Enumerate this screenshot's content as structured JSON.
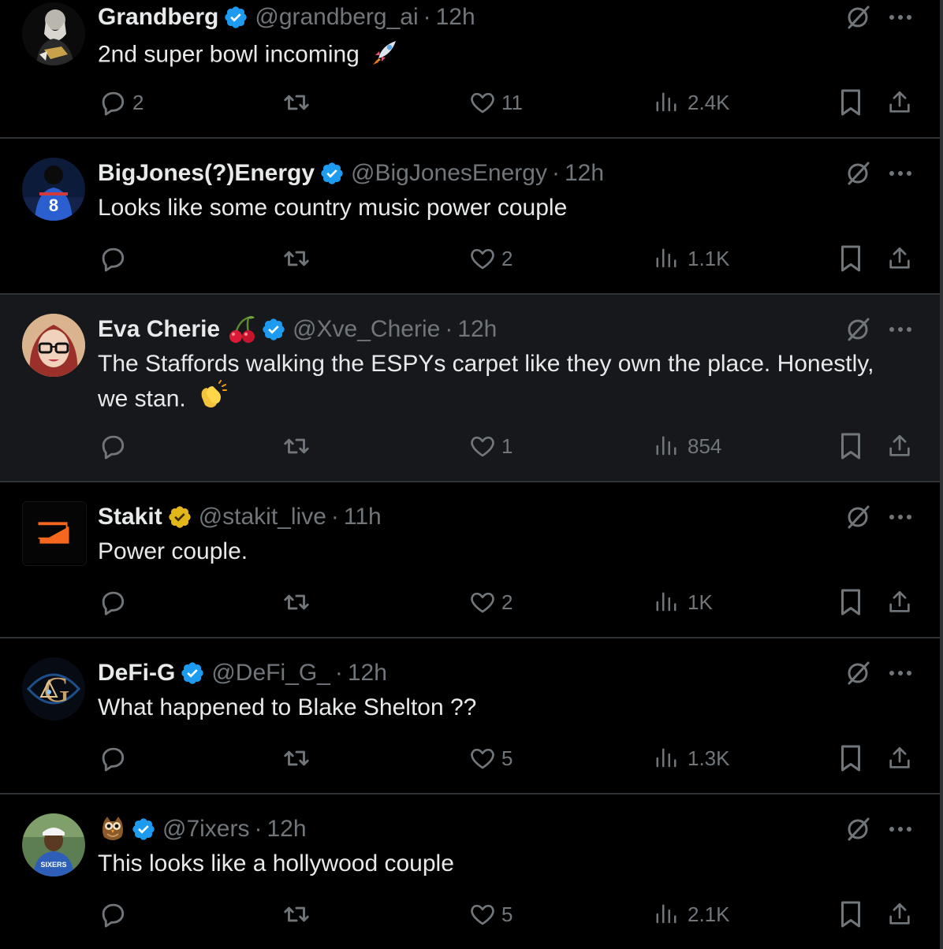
{
  "tweets": [
    {
      "name": "Grandberg",
      "name_emoji": "",
      "verified": "blue",
      "handle": "@grandberg_ai",
      "separator": "·",
      "time": "12h",
      "text": "2nd super bowl incoming",
      "text_emoji": "rocket",
      "replies": "2",
      "retweets": "",
      "likes": "11",
      "views": "2.4K",
      "avatar": "bearded-man-avatar"
    },
    {
      "name": "BigJones(?)Energy",
      "name_emoji": "",
      "verified": "blue",
      "handle": "@BigJonesEnergy",
      "separator": "·",
      "time": "12h",
      "text": "Looks like some country music power couple",
      "text_emoji": "",
      "replies": "",
      "retweets": "",
      "likes": "2",
      "views": "1.1K",
      "avatar": "football-player-avatar"
    },
    {
      "name": "Eva Cherie",
      "name_emoji": "cherries",
      "verified": "blue",
      "handle": "@Xve_Cherie",
      "separator": "·",
      "time": "12h",
      "text_line1": "The Staffords walking the ESPYs carpet like they own the place. Honestly,",
      "text_line2": "we stan.",
      "text_emoji": "clapping-hands",
      "replies": "",
      "retweets": "",
      "likes": "1",
      "views": "854",
      "avatar": "woman-glasses-avatar"
    },
    {
      "name": "Stakit",
      "name_emoji": "",
      "verified": "gold",
      "handle": "@stakit_live",
      "separator": "·",
      "time": "11h",
      "text": "Power couple.",
      "text_emoji": "",
      "replies": "",
      "retweets": "",
      "likes": "2",
      "views": "1K",
      "avatar": "stakit-logo-avatar"
    },
    {
      "name": "DeFi-G",
      "name_emoji": "",
      "verified": "blue",
      "handle": "@DeFi_G_",
      "separator": "·",
      "time": "12h",
      "text": "What happened to Blake Shelton ??",
      "text_emoji": "",
      "replies": "",
      "retweets": "",
      "likes": "5",
      "views": "1.3K",
      "avatar": "eye-g-logo-avatar"
    },
    {
      "name": "",
      "name_emoji": "owl",
      "verified": "blue",
      "handle": "@7ixers",
      "separator": "·",
      "time": "12h",
      "text": "This looks like a hollywood couple",
      "text_emoji": "",
      "replies": "",
      "retweets": "",
      "likes": "5",
      "views": "2.1K",
      "avatar": "man-cap-avatar"
    }
  ],
  "icons": {
    "grok": "grok-icon",
    "more": "more-icon",
    "reply": "reply-icon",
    "retweet": "retweet-icon",
    "like": "like-icon",
    "views": "views-icon",
    "bookmark": "bookmark-icon",
    "share": "share-icon"
  },
  "colors": {
    "background": "#000000",
    "highlight_background": "#16181c",
    "text": "#e7e9ea",
    "secondary_text": "#71767b",
    "divider": "#2f3336",
    "verified_blue": "#1d9bf0",
    "verified_gold": "#e2b719"
  }
}
